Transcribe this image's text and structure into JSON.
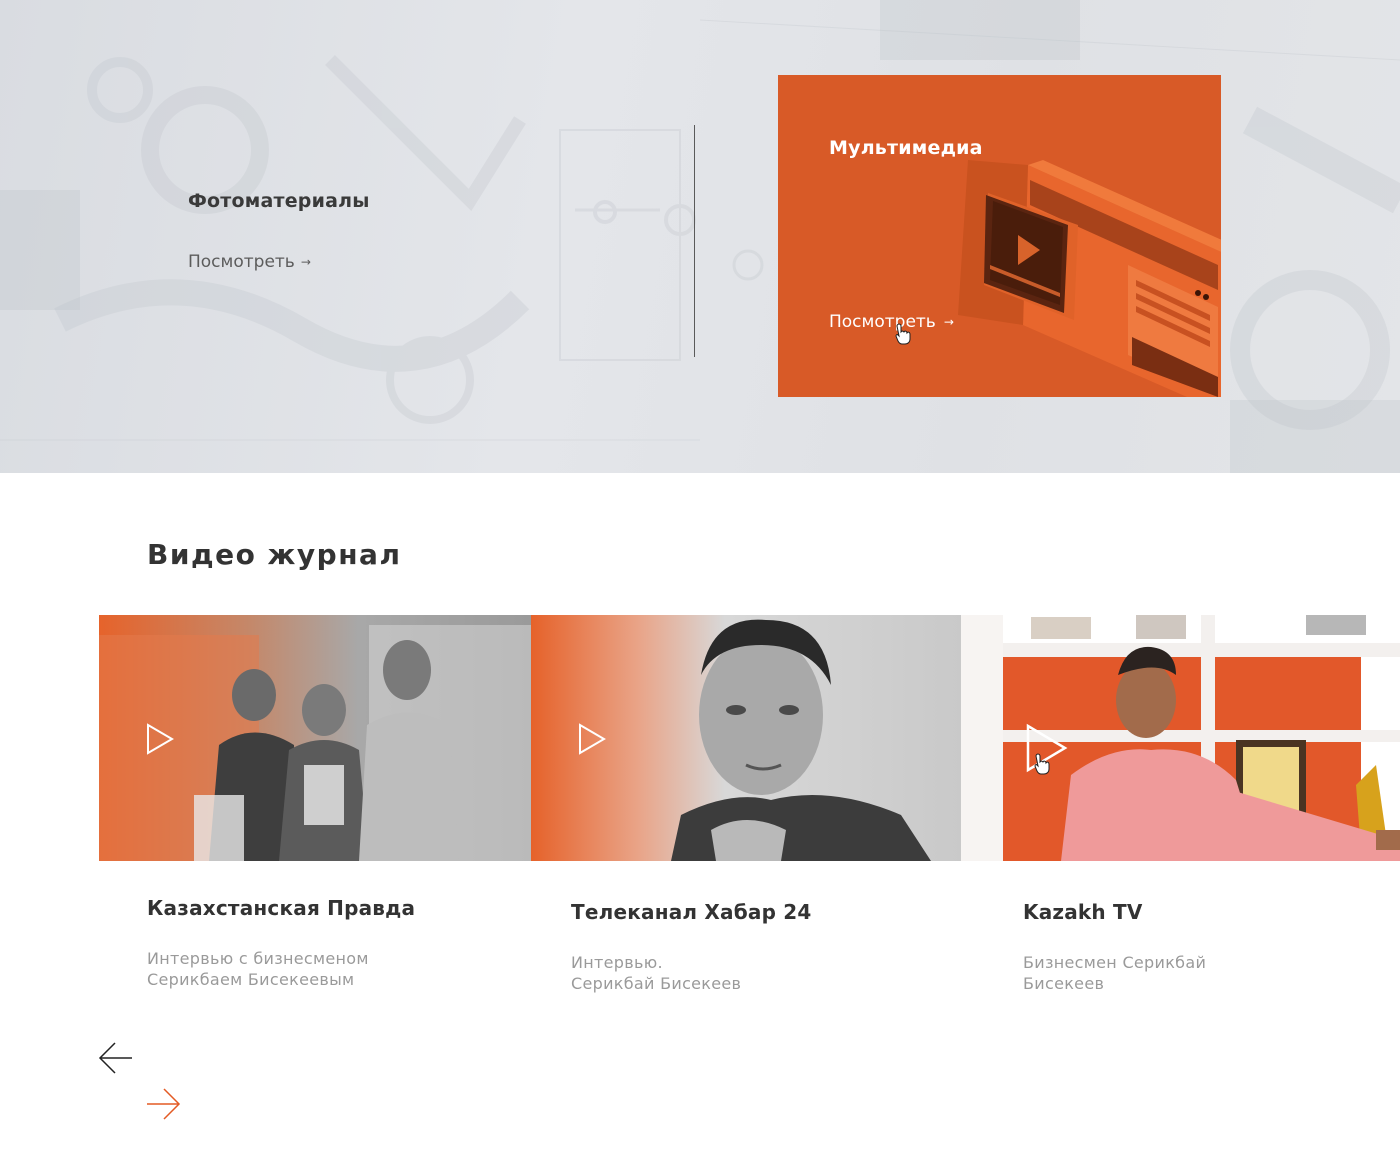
{
  "banner": {
    "photos": {
      "title": "Фотоматериалы",
      "link_label": "Посмотреть",
      "link_arrow": "→"
    },
    "multimedia": {
      "title": "Мультимедиа",
      "link_label": "Посмотреть",
      "link_arrow": "→",
      "accent_color": "#d85a27"
    }
  },
  "video_journal": {
    "title": "Видео журнал",
    "cards": [
      {
        "heading": "Казахстанская Правда",
        "desc_line1": "Интервью с бизнесменом",
        "desc_line2": "Серикбаем Бисекеевым",
        "icon": "play-icon"
      },
      {
        "heading": "Телеканал Хабар 24",
        "desc_line1": "Интервью.",
        "desc_line2": "Серикбай Бисекеев",
        "icon": "play-icon"
      },
      {
        "heading": "Kazakh TV",
        "desc_line1": "Бизнесмен Серикбай",
        "desc_line2": "Бисекеев",
        "icon": "play-icon"
      }
    ],
    "nav": {
      "prev_icon": "arrow-left-icon",
      "next_icon": "arrow-right-icon",
      "next_color": "#e35a24"
    }
  }
}
